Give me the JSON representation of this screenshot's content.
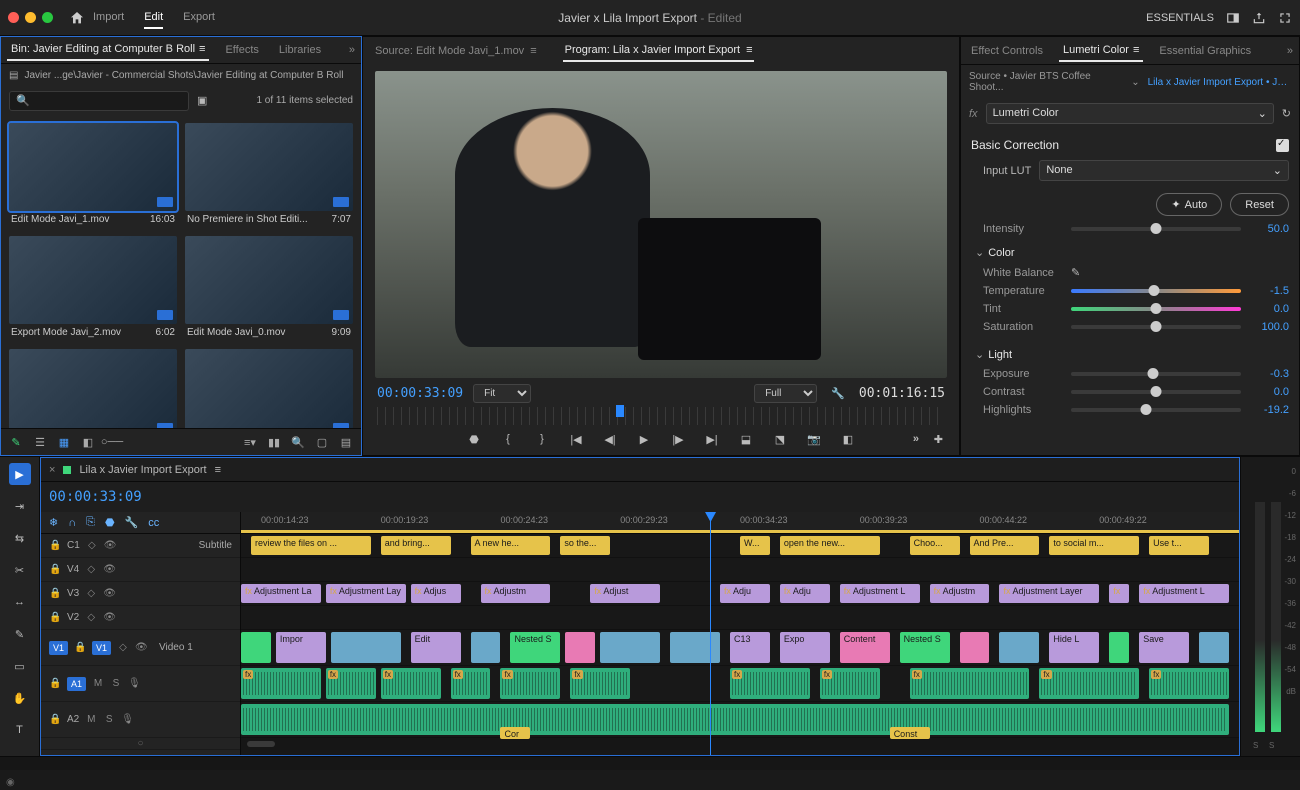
{
  "top": {
    "nav": [
      "Import",
      "Edit",
      "Export"
    ],
    "activeNav": "Edit",
    "title": "Javier x Lila Import Export",
    "edited": "- Edited",
    "workspace": "ESSENTIALS"
  },
  "project": {
    "tabs": {
      "bin": "Bin: Javier Editing at Computer B Roll",
      "effects": "Effects",
      "libraries": "Libraries"
    },
    "breadcrumb": "Javier ...ge\\Javier - Commercial Shots\\Javier Editing at Computer B Roll",
    "searchPlaceholder": "",
    "selection": "1 of 11 items selected",
    "clips": [
      {
        "name": "Edit Mode Javi_1.mov",
        "dur": "16:03",
        "sel": true
      },
      {
        "name": "No Premiere in Shot Editi...",
        "dur": "7:07"
      },
      {
        "name": "Export Mode Javi_2.mov",
        "dur": "6:02"
      },
      {
        "name": "Edit Mode Javi_0.mov",
        "dur": "9:09"
      }
    ]
  },
  "monitors": {
    "sourceTab": "Source: Edit Mode Javi_1.mov",
    "programTab": "Program: Lila x Javier Import Export",
    "tcLeft": "00:00:33:09",
    "fit": "Fit",
    "full": "Full",
    "tcRight": "00:01:16:15"
  },
  "lumetri": {
    "tabs": {
      "ec": "Effect Controls",
      "lc": "Lumetri Color",
      "eg": "Essential Graphics"
    },
    "source": "Source • Javier BTS Coffee Shoot...",
    "sequence": "Lila x Javier Import Export • Jav...",
    "effect": "Lumetri Color",
    "basic": "Basic Correction",
    "inputLut": "Input LUT",
    "lutValue": "None",
    "auto": "Auto",
    "reset": "Reset",
    "sliders": {
      "intensity": {
        "l": "Intensity",
        "v": "50.0",
        "p": 50
      },
      "temperature": {
        "l": "Temperature",
        "v": "-1.5",
        "p": 49
      },
      "tint": {
        "l": "Tint",
        "v": "0.0",
        "p": 50
      },
      "saturation": {
        "l": "Saturation",
        "v": "100.0",
        "p": 50
      },
      "exposure": {
        "l": "Exposure",
        "v": "-0.3",
        "p": 48
      },
      "contrast": {
        "l": "Contrast",
        "v": "0.0",
        "p": 50
      },
      "highlights": {
        "l": "Highlights",
        "v": "-19.2",
        "p": 44
      }
    },
    "groups": {
      "color": "Color",
      "wb": "White Balance",
      "light": "Light"
    }
  },
  "timeline": {
    "seqName": "Lila x Javier Import Export",
    "tc": "00:00:33:09",
    "rulerTicks": [
      "00:00:14:23",
      "00:00:19:23",
      "00:00:24:23",
      "00:00:29:23",
      "00:00:34:23",
      "00:00:39:23",
      "00:00:44:22",
      "00:00:49:22"
    ],
    "tracks": {
      "c1": {
        "label": "C1",
        "name": "Subtitle"
      },
      "v4": {
        "label": "V4"
      },
      "v3": {
        "label": "V3"
      },
      "v2": {
        "label": "V2"
      },
      "v1": {
        "label": "V1",
        "name": "Video 1",
        "src": "V1"
      },
      "a1": {
        "label": "A1"
      },
      "a2": {
        "label": "A2"
      }
    },
    "captions": [
      "review the files on ...",
      "and bring...",
      "A new he...",
      "so the...",
      "W...",
      "open the new...",
      "Choo...",
      "And Pre...",
      "to social m...",
      "Use t..."
    ],
    "adjLabels": [
      "Adjustment La",
      "Adjustment Lay",
      "Adjus",
      "Adjustm",
      "Adjust",
      "Adju",
      "Adju",
      "Adjustment L",
      "Adjustm",
      "Adjustment Layer",
      "Adjustment L"
    ],
    "v1Labels": [
      "Impor",
      "Edit",
      "Nested S",
      "C13",
      "Expo",
      "Content",
      "Nested S",
      "Hide L",
      "Save"
    ],
    "audioMarkers": [
      "Cor",
      "Const"
    ]
  },
  "meters": {
    "db": [
      "0",
      "-6",
      "-12",
      "-18",
      "-24",
      "-30",
      "-36",
      "-42",
      "-48",
      "-54",
      "dB"
    ],
    "solo": "S"
  }
}
